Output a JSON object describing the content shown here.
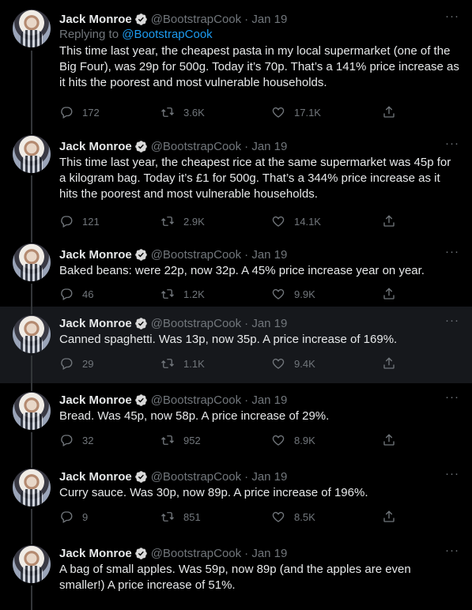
{
  "tweets": [
    {
      "name": "Jack Monroe",
      "handle": "@BootstrapCook",
      "date": "· Jan 19",
      "replying_prefix": "Replying to ",
      "replying_to": "@BootstrapCook",
      "text": "This time last year, the cheapest pasta in my local supermarket (one of the Big Four), was 29p for 500g. Today it’s 70p. That’s a 141% price increase as it hits the poorest and most vulnerable households.",
      "replies": "172",
      "retweets": "3.6K",
      "likes": "17.1K"
    },
    {
      "name": "Jack Monroe",
      "handle": "@BootstrapCook",
      "date": "· Jan 19",
      "text": "This time last year, the cheapest rice at the same supermarket was 45p for a kilogram bag. Today it’s £1 for 500g. That’s a 344% price increase as it hits the poorest and most vulnerable households.",
      "replies": "121",
      "retweets": "2.9K",
      "likes": "14.1K"
    },
    {
      "name": "Jack Monroe",
      "handle": "@BootstrapCook",
      "date": "· Jan 19",
      "text": "Baked beans: were 22p, now 32p. A 45% price increase year on year.",
      "replies": "46",
      "retweets": "1.2K",
      "likes": "9.9K"
    },
    {
      "name": "Jack Monroe",
      "handle": "@BootstrapCook",
      "date": "· Jan 19",
      "text": "Canned spaghetti. Was 13p, now 35p. A price increase of 169%.",
      "replies": "29",
      "retweets": "1.1K",
      "likes": "9.4K"
    },
    {
      "name": "Jack Monroe",
      "handle": "@BootstrapCook",
      "date": "· Jan 19",
      "text": "Bread. Was 45p, now 58p. A price increase of 29%.",
      "replies": "32",
      "retweets": "952",
      "likes": "8.9K"
    },
    {
      "name": "Jack Monroe",
      "handle": "@BootstrapCook",
      "date": "· Jan 19",
      "text": "Curry sauce. Was 30p, now 89p. A price increase of 196%.",
      "replies": "9",
      "retweets": "851",
      "likes": "8.5K"
    },
    {
      "name": "Jack Monroe",
      "handle": "@BootstrapCook",
      "date": "· Jan 19",
      "text": "A bag of small apples. Was 59p, now 89p (and the apples are even smaller!) A price increase of 51%."
    }
  ],
  "colors": {
    "background": "#000000",
    "highlight_background": "#16181c",
    "text": "#e7e9ea",
    "secondary_text": "#71767b",
    "link": "#1d9bf0",
    "verified_badge": "#d9d9d9"
  },
  "icons": {
    "more": "more-dots-icon",
    "verified": "verified-badge-icon",
    "reply": "reply-icon",
    "retweet": "retweet-icon",
    "like": "heart-icon",
    "share": "share-icon"
  }
}
